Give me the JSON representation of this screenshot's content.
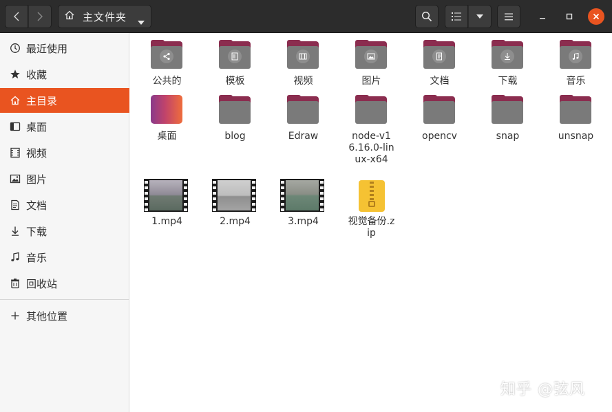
{
  "header": {
    "path_label": "主文件夹"
  },
  "sidebar": {
    "items": [
      {
        "label": "最近使用",
        "icon": "clock-icon"
      },
      {
        "label": "收藏",
        "icon": "star-icon"
      },
      {
        "label": "主目录",
        "icon": "home-icon",
        "active": true
      },
      {
        "label": "桌面",
        "icon": "desktop-icon"
      },
      {
        "label": "视频",
        "icon": "film-icon"
      },
      {
        "label": "图片",
        "icon": "image-icon"
      },
      {
        "label": "文档",
        "icon": "document-icon"
      },
      {
        "label": "下载",
        "icon": "download-icon"
      },
      {
        "label": "音乐",
        "icon": "music-icon"
      },
      {
        "label": "回收站",
        "icon": "trash-icon"
      }
    ],
    "other_locations": {
      "label": "其他位置",
      "icon": "plus-icon"
    }
  },
  "files": [
    {
      "name": "公共的",
      "type": "folder",
      "emblem": "share-icon"
    },
    {
      "name": "模板",
      "type": "folder",
      "emblem": "template-icon"
    },
    {
      "name": "视频",
      "type": "folder",
      "emblem": "film-icon"
    },
    {
      "name": "图片",
      "type": "folder",
      "emblem": "image-icon"
    },
    {
      "name": "文档",
      "type": "folder",
      "emblem": "document-icon"
    },
    {
      "name": "下载",
      "type": "folder",
      "emblem": "download-icon"
    },
    {
      "name": "音乐",
      "type": "folder",
      "emblem": "music-icon"
    },
    {
      "name": "桌面",
      "type": "desktop-folder"
    },
    {
      "name": "blog",
      "type": "folder"
    },
    {
      "name": "Edraw",
      "type": "folder"
    },
    {
      "name": "node-v16.16.0-linux-x64",
      "type": "folder"
    },
    {
      "name": "opencv",
      "type": "folder"
    },
    {
      "name": "snap",
      "type": "folder"
    },
    {
      "name": "unsnap",
      "type": "folder"
    },
    {
      "name": "1.mp4",
      "type": "video"
    },
    {
      "name": "2.mp4",
      "type": "video"
    },
    {
      "name": "3.mp4",
      "type": "video"
    },
    {
      "name": "视觉备份.zip",
      "type": "zip"
    }
  ],
  "watermark": "知乎 @弦风",
  "colors": {
    "accent": "#e95420",
    "folder_tab": "#8b2d4f",
    "folder_body": "#7a7a7a",
    "header_bg": "#2c2c2c"
  }
}
